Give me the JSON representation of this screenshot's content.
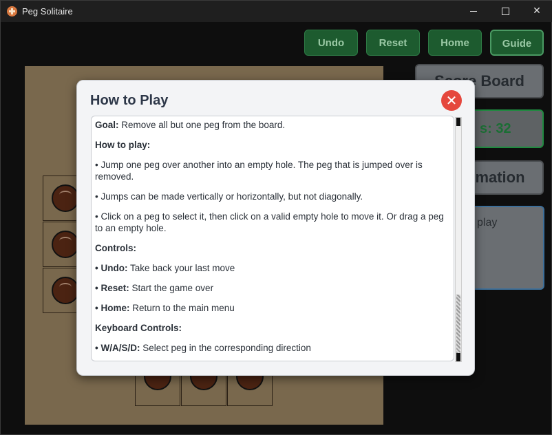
{
  "window": {
    "title": "Peg Solitaire",
    "minimize_label": "",
    "maximize_label": "",
    "close_label": "✕"
  },
  "toolbar": {
    "undo": "Undo",
    "reset": "Reset",
    "home": "Home",
    "guide": "Guide"
  },
  "sidebar": {
    "score_board": "Score Board",
    "score_text": "s: 32",
    "information": "mation",
    "info_text": "play"
  },
  "modal": {
    "title": "How to Play",
    "close": "✕",
    "goal_label": "Goal:",
    "goal_text": " Remove all but one peg from the board.",
    "how_label": "How to play:",
    "rule1": "• Jump one peg over another into an empty hole. The peg that is jumped over is removed.",
    "rule2": "• Jumps can be made vertically or horizontally, but not diagonally.",
    "rule3": "• Click on a peg to select it, then click on a valid empty hole to move it. Or drag a peg to an empty hole.",
    "controls_label": "Controls:",
    "undo_label": "• Undo:",
    "undo_text": " Take back your last move",
    "reset_label": "• Reset:",
    "reset_text": " Start the game over",
    "home_label": "• Home:",
    "home_text": " Return to the main menu",
    "keyboard_label": "Keyboard Controls:",
    "wasd_label": "• W/A/S/D:",
    "wasd_text": " Select peg in the corresponding direction"
  },
  "colors": {
    "board": "#79684d",
    "peg": "#4b2312",
    "button_green": "#1d5b2f",
    "close_red": "#e5473d"
  }
}
